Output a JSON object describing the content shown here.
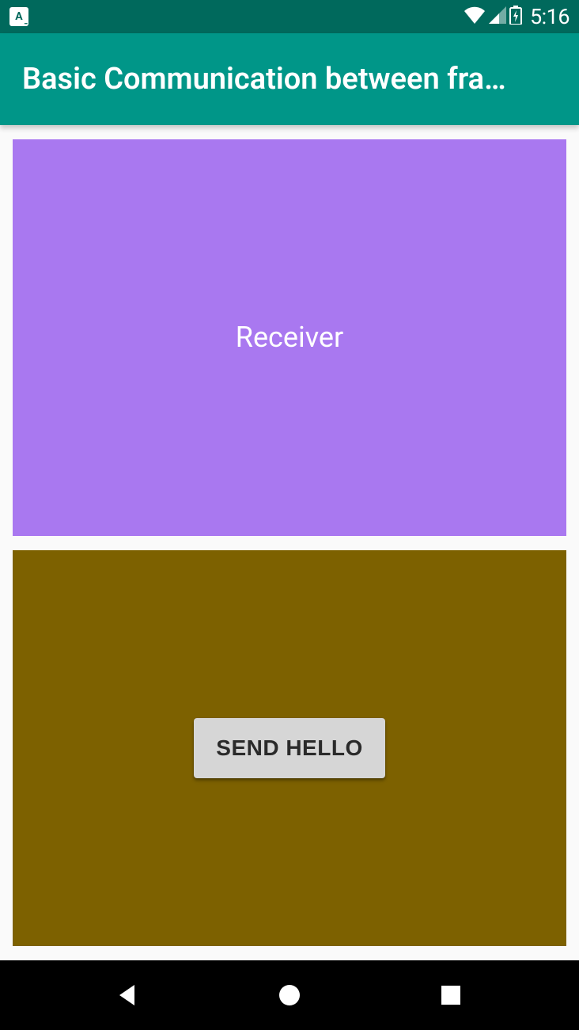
{
  "status_bar": {
    "keyboard_indicator": "A",
    "time": "5:16"
  },
  "action_bar": {
    "title": "Basic Communication between fra…"
  },
  "receiver_fragment": {
    "label": "Receiver"
  },
  "sender_fragment": {
    "button_label": "SEND HELLO"
  },
  "colors": {
    "status_bar": "#00695c",
    "action_bar": "#009688",
    "receiver_bg": "#a978f0",
    "sender_bg": "#7d6100",
    "button_bg": "#d6d6d6"
  }
}
